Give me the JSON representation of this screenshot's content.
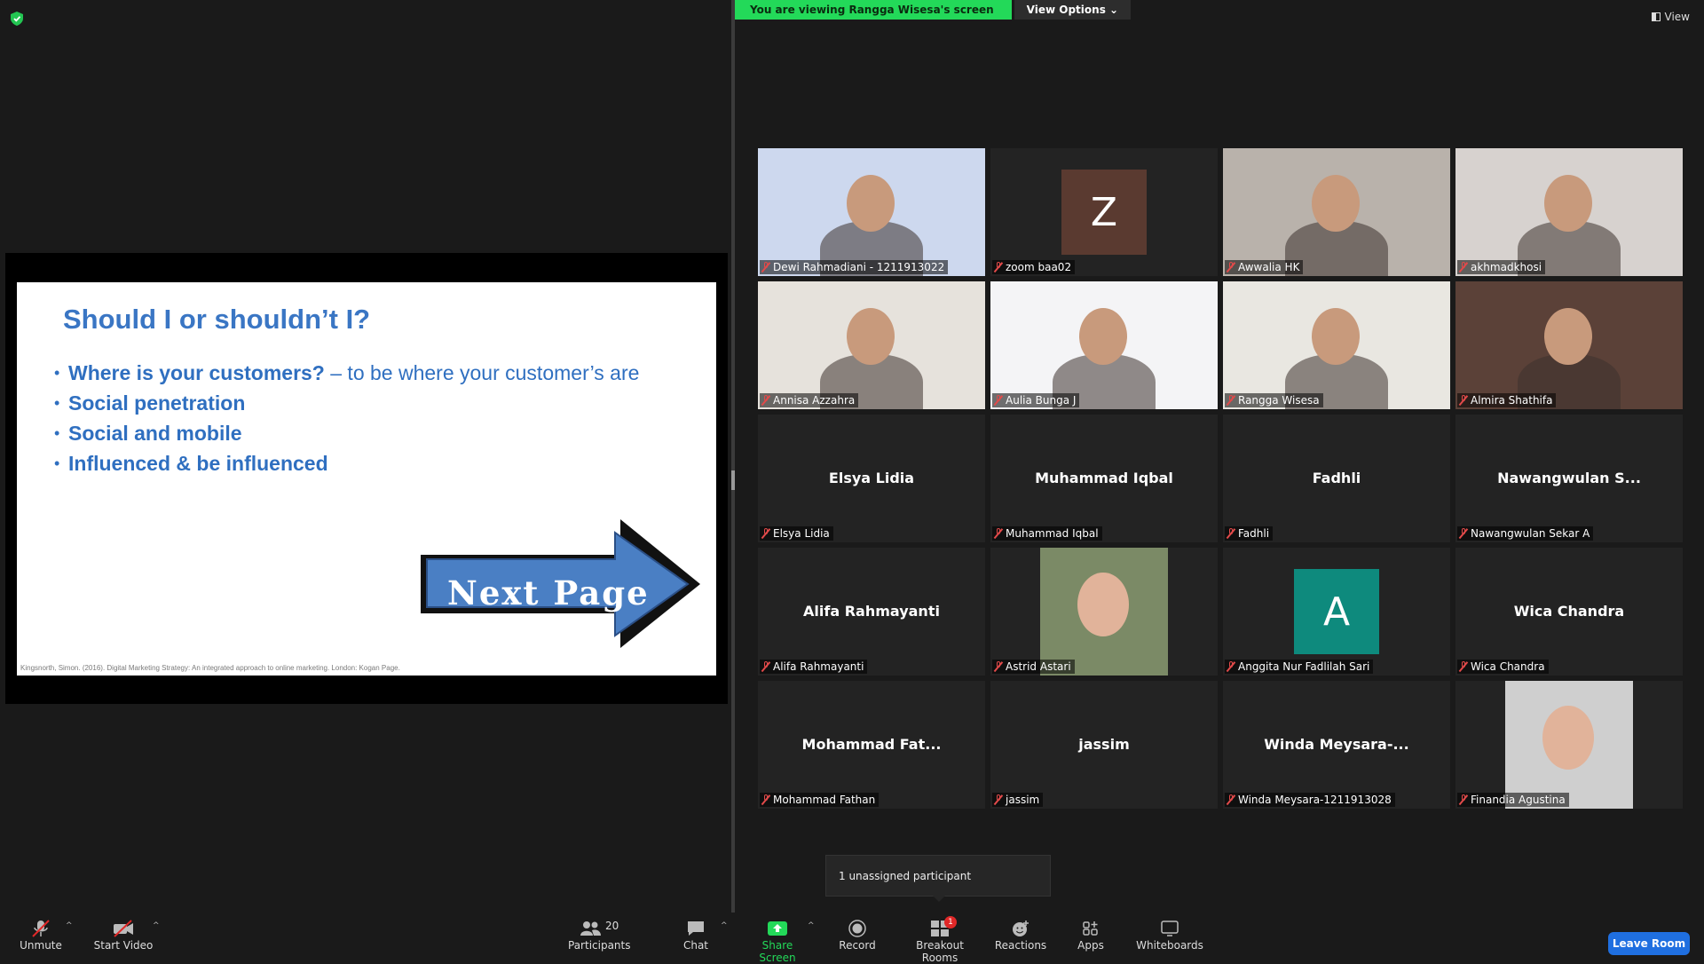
{
  "banner": {
    "viewing": "You are viewing Rangga Wisesa's screen",
    "options": "View Options"
  },
  "top_view": "View",
  "slide": {
    "title": "Should I or shouldn’t I?",
    "bullets": [
      {
        "bold": "Where is your customers?",
        "rest": " – to be where your customer’s are"
      },
      {
        "bold": "Social penetration",
        "rest": ""
      },
      {
        "bold": "Social and mobile",
        "rest": ""
      },
      {
        "bold": "Influenced & be influenced",
        "rest": ""
      }
    ],
    "button": "Next Page",
    "citation": "Kingsnorth, Simon. (2016). Digital Marketing Strategy: An integrated approach to online marketing. London: Kogan Page."
  },
  "participants": [
    {
      "label": "Dewi Rahmadiani - 1211913022",
      "center": "",
      "kind": "video",
      "bg": "#cdd8ee"
    },
    {
      "label": "zoom baa02",
      "center": "",
      "kind": "letter",
      "letter": "Z",
      "bg": "#5a3a30"
    },
    {
      "label": "Awwalia HK",
      "center": "",
      "kind": "video",
      "bg": "#b9b2ab"
    },
    {
      "label": "akhmadkhosi",
      "center": "",
      "kind": "video",
      "bg": "#d7d2cf"
    },
    {
      "label": "Annisa Azzahra",
      "center": "",
      "kind": "video",
      "bg": "#e6e2dc"
    },
    {
      "label": "Aulia Bunga J",
      "center": "",
      "kind": "video",
      "bg": "#f4f4f6"
    },
    {
      "label": "Rangga Wisesa",
      "center": "",
      "kind": "video",
      "bg": "#e9e7e1",
      "active": true
    },
    {
      "label": "Almira Shathifa",
      "center": "",
      "kind": "video",
      "bg": "#5b4138"
    },
    {
      "label": "Elsya Lidia",
      "center": "Elsya Lidia",
      "kind": "name"
    },
    {
      "label": "Muhammad Iqbal",
      "center": "Muhammad Iqbal",
      "kind": "name"
    },
    {
      "label": "Fadhli",
      "center": "Fadhli",
      "kind": "name"
    },
    {
      "label": "Nawangwulan Sekar A",
      "center": "Nawangwulan S...",
      "kind": "name"
    },
    {
      "label": "Alifa Rahmayanti",
      "center": "Alifa Rahmayanti",
      "kind": "name"
    },
    {
      "label": "Astrid Astari",
      "center": "",
      "kind": "photo",
      "bg": "#7b8a66"
    },
    {
      "label": "Anggita Nur Fadlilah Sari",
      "center": "",
      "kind": "letter",
      "letter": "A",
      "bg": "#0e8a7d"
    },
    {
      "label": "Wica Chandra",
      "center": "Wica Chandra",
      "kind": "name"
    },
    {
      "label": "Mohammad Fathan",
      "center": "Mohammad  Fat...",
      "kind": "name"
    },
    {
      "label": "jassim",
      "center": "jassim",
      "kind": "name"
    },
    {
      "label": "Winda Meysara-1211913028",
      "center": "Winda  Meysara-...",
      "kind": "name"
    },
    {
      "label": "Finandia Agustina",
      "center": "",
      "kind": "photo",
      "bg": "#cfcfcf"
    }
  ],
  "toast": "1 unassigned participant",
  "toolbar": {
    "unmute": "Unmute",
    "start_video": "Start Video",
    "participants_count": "20",
    "participants": "Participants",
    "chat": "Chat",
    "share_screen": "Share Screen",
    "record": "Record",
    "breakout_badge": "1",
    "breakout": "Breakout Rooms",
    "reactions": "Reactions",
    "apps": "Apps",
    "whiteboards": "Whiteboards",
    "leave": "Leave Room"
  },
  "colors": {
    "share_green": "#23d959",
    "leave_blue": "#1f6fe0",
    "active_border": "#e8e45a",
    "slide_blue": "#3a76c4"
  }
}
